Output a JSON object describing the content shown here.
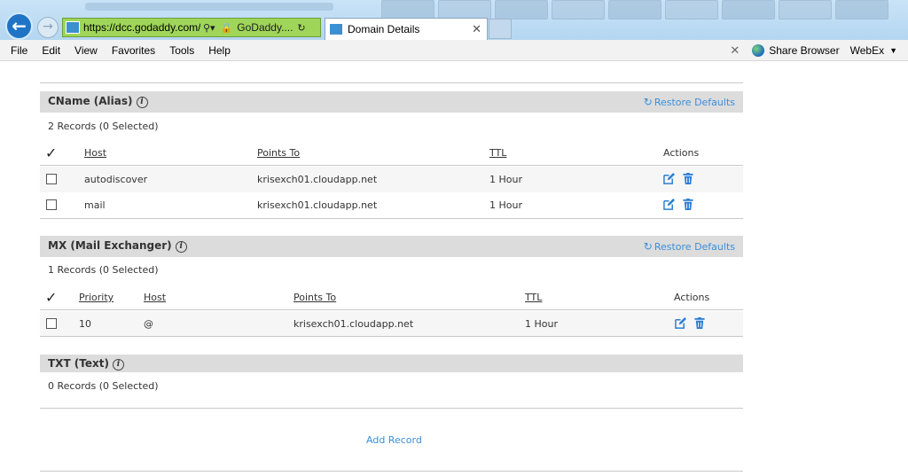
{
  "browser": {
    "url": "https://dcc.godaddy.com/dc",
    "site_identity": "GoDaddy....",
    "tab_title": "Domain Details",
    "menu": [
      "File",
      "Edit",
      "View",
      "Favorites",
      "Tools",
      "Help"
    ],
    "share_browser_label": "Share Browser",
    "webex_label": "WebEx"
  },
  "cname": {
    "title": "CName (Alias)",
    "restore_label": "Restore Defaults",
    "record_count": "2 Records (0 Selected)",
    "headers": {
      "host": "Host",
      "points_to": "Points To",
      "ttl": "TTL",
      "actions": "Actions"
    },
    "rows": [
      {
        "host": "autodiscover",
        "points_to": "krisexch01.cloudapp.net",
        "ttl": "1 Hour"
      },
      {
        "host": "mail",
        "points_to": "krisexch01.cloudapp.net",
        "ttl": "1 Hour"
      }
    ]
  },
  "mx": {
    "title": "MX (Mail Exchanger)",
    "restore_label": "Restore Defaults",
    "record_count": "1 Records (0 Selected)",
    "headers": {
      "priority": "Priority",
      "host": "Host",
      "points_to": "Points To",
      "ttl": "TTL",
      "actions": "Actions"
    },
    "rows": [
      {
        "priority": "10",
        "host": "@",
        "points_to": "krisexch01.cloudapp.net",
        "ttl": "1 Hour"
      }
    ]
  },
  "txt": {
    "title": "TXT (Text)",
    "record_count": "0 Records (0 Selected)"
  },
  "add_record_label": "Add Record",
  "colors": {
    "accent": "#3b8fd9",
    "section_header_bg": "#dcdcdc",
    "address_bar_secure": "#9fd65a"
  }
}
